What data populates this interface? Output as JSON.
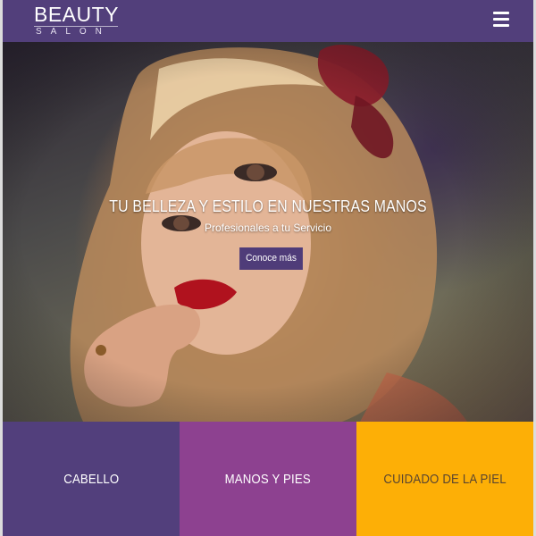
{
  "header": {
    "logo_title": "BEAUTY",
    "logo_subtitle": "SALON",
    "menu_icon": "hamburger-menu-icon"
  },
  "hero": {
    "title": "TU BELLEZA Y ESTILO EN NUESTRAS MANOS",
    "subtitle": "Profesionales a tu Servicio",
    "button_label": "Conoce más"
  },
  "tiles": [
    {
      "label": "CABELLO",
      "color": "#523f7c"
    },
    {
      "label": "MANOS Y PIES",
      "color": "#8d4190"
    },
    {
      "label": "CUIDADO DE LA PIEL",
      "color": "#fdaf06"
    }
  ],
  "colors": {
    "brand_purple": "#523f7b",
    "magenta": "#8d4190",
    "amber": "#fdaf06"
  }
}
